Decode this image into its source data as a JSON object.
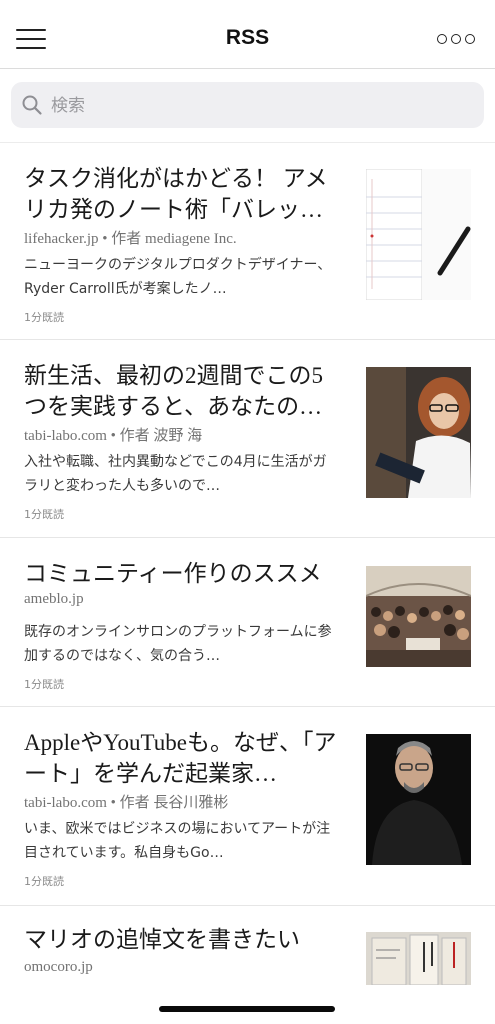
{
  "nav": {
    "title": "RSS",
    "menu_icon": "hamburger-menu-icon",
    "more_icon": "more-options-icon"
  },
  "search": {
    "placeholder": "検索",
    "icon": "search-icon"
  },
  "articles": [
    {
      "title": "タスク消化がはかどる！ アメリカ発のノート術「バレッ…",
      "source": "lifehacker.jp • 作者 mediagene Inc.",
      "summary": "ニューヨークのデジタルプロダクトデザイナー、Ryder Carroll氏が考案したノ…",
      "time": "1分既読",
      "thumbnail": "notebook-pen-image"
    },
    {
      "title": "新生活、最初の2週間でこの5つを実践すると、あなたの…",
      "source": "tabi-labo.com • 作者 波野 海",
      "summary": "入社や転職、社内異動などでこの4月に生活がガラリと変わった人も多いので…",
      "time": "1分既読",
      "thumbnail": "woman-with-clipboard-image"
    },
    {
      "title": "コミュニティー作りのススメ",
      "source": "ameblo.jp",
      "summary": "既存のオンラインサロンのプラットフォームに参加するのではなく、気の合う…",
      "time": "1分既読",
      "thumbnail": "group-photo-image"
    },
    {
      "title": "AppleやYouTubeも。なぜ、「アート」を学んだ起業家…",
      "source": "tabi-labo.com • 作者 長谷川雅彬",
      "summary": "いま、欧米ではビジネスの場においてアートが注目されています。私自身もGo…",
      "time": "1分既読",
      "thumbnail": "man-in-black-turtleneck-image"
    },
    {
      "title": "マリオの追悼文を書きたい",
      "source": "omocoro.jp",
      "summary": "",
      "time": "",
      "thumbnail": "book-covers-image"
    }
  ]
}
